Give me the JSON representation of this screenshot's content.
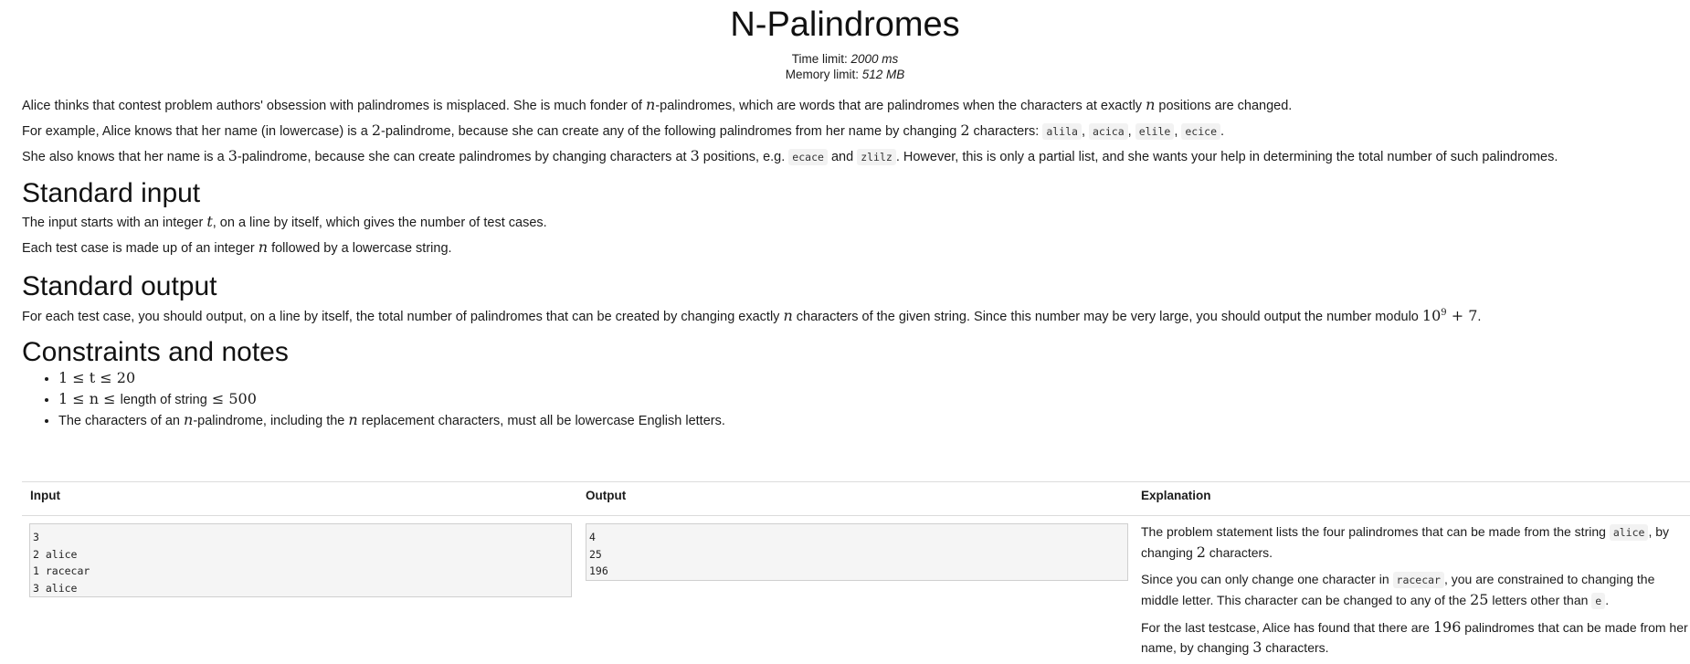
{
  "title": "N-Palindromes",
  "limits": {
    "time_label": "Time limit:",
    "time_value": "2000 ms",
    "memory_label": "Memory limit:",
    "memory_value": "512 MB"
  },
  "statement": {
    "p1_a": "Alice thinks that contest problem authors' obsession with palindromes is misplaced. She is much fonder of ",
    "p1_var": "n",
    "p1_b": "-palindromes, which are words that are palindromes when the characters at exactly ",
    "p1_var2": "n",
    "p1_c": " positions are changed.",
    "p2_a": "For example, Alice knows that her name (in lowercase) is a ",
    "p2_num": "2",
    "p2_b": "-palindrome, because she can create any of the following palindromes from her name by changing ",
    "p2_num2": "2",
    "p2_c": " characters: ",
    "p2_codes": [
      "alila",
      "acica",
      "elile",
      "ecice"
    ],
    "p3_a": "She also knows that her name is a ",
    "p3_num": "3",
    "p3_b": "-palindrome, because she can create palindromes by changing characters at ",
    "p3_num2": "3",
    "p3_c": " positions, e.g. ",
    "p3_code1": "ecace",
    "p3_and": "and",
    "p3_code2": "zlilz",
    "p3_d": ". However, this is only a partial list, and she wants your help in determining the total number of such palindromes."
  },
  "input_section": {
    "heading": "Standard input",
    "p1_a": "The input starts with an integer ",
    "p1_var": "t",
    "p1_b": ", on a line by itself, which gives the number of test cases.",
    "p2_a": "Each test case is made up of an integer ",
    "p2_var": "n",
    "p2_b": " followed by a lowercase string."
  },
  "output_section": {
    "heading": "Standard output",
    "p1_a": "For each test case, you should output, on a line by itself, the total number of palindromes that can be created by changing exactly ",
    "p1_var": "n",
    "p1_b": " characters of the given string. Since this number may be very large, you should output the number modulo ",
    "p1_base": "10",
    "p1_exp": "9",
    "p1_tail": " + 7",
    "p1_end": "."
  },
  "constraints": {
    "heading": "Constraints and notes",
    "c1": "1 ≤ t ≤ 20",
    "c2_a": "1 ≤ n ≤ ",
    "c2_b": "length of string",
    "c2_c": " ≤ 500",
    "c3_a": "The characters of an ",
    "c3_var": "n",
    "c3_b": "-palindrome, including the ",
    "c3_var2": "n",
    "c3_c": " replacement characters, must all be lowercase English letters."
  },
  "example": {
    "headers": {
      "input": "Input",
      "output": "Output",
      "explanation": "Explanation"
    },
    "input_text": "3\n2 alice\n1 racecar\n3 alice",
    "output_text": "4\n25\n196",
    "e1_a": "The problem statement lists the four palindromes that can be made from the string ",
    "e1_code": "alice",
    "e1_b": ", by changing ",
    "e1_num": "2",
    "e1_c": " characters.",
    "e2_a": "Since you can only change one character in ",
    "e2_code": "racecar",
    "e2_b": ", you are constrained to changing the middle letter. This character can be changed to any of the ",
    "e2_num": "25",
    "e2_c": " letters other than ",
    "e2_code2": "e",
    "e2_d": ".",
    "e3_a": "For the last testcase, Alice has found that there are ",
    "e3_num": "196",
    "e3_b": " palindromes that can be made from her name, by changing ",
    "e3_num2": "3",
    "e3_c": " characters."
  }
}
